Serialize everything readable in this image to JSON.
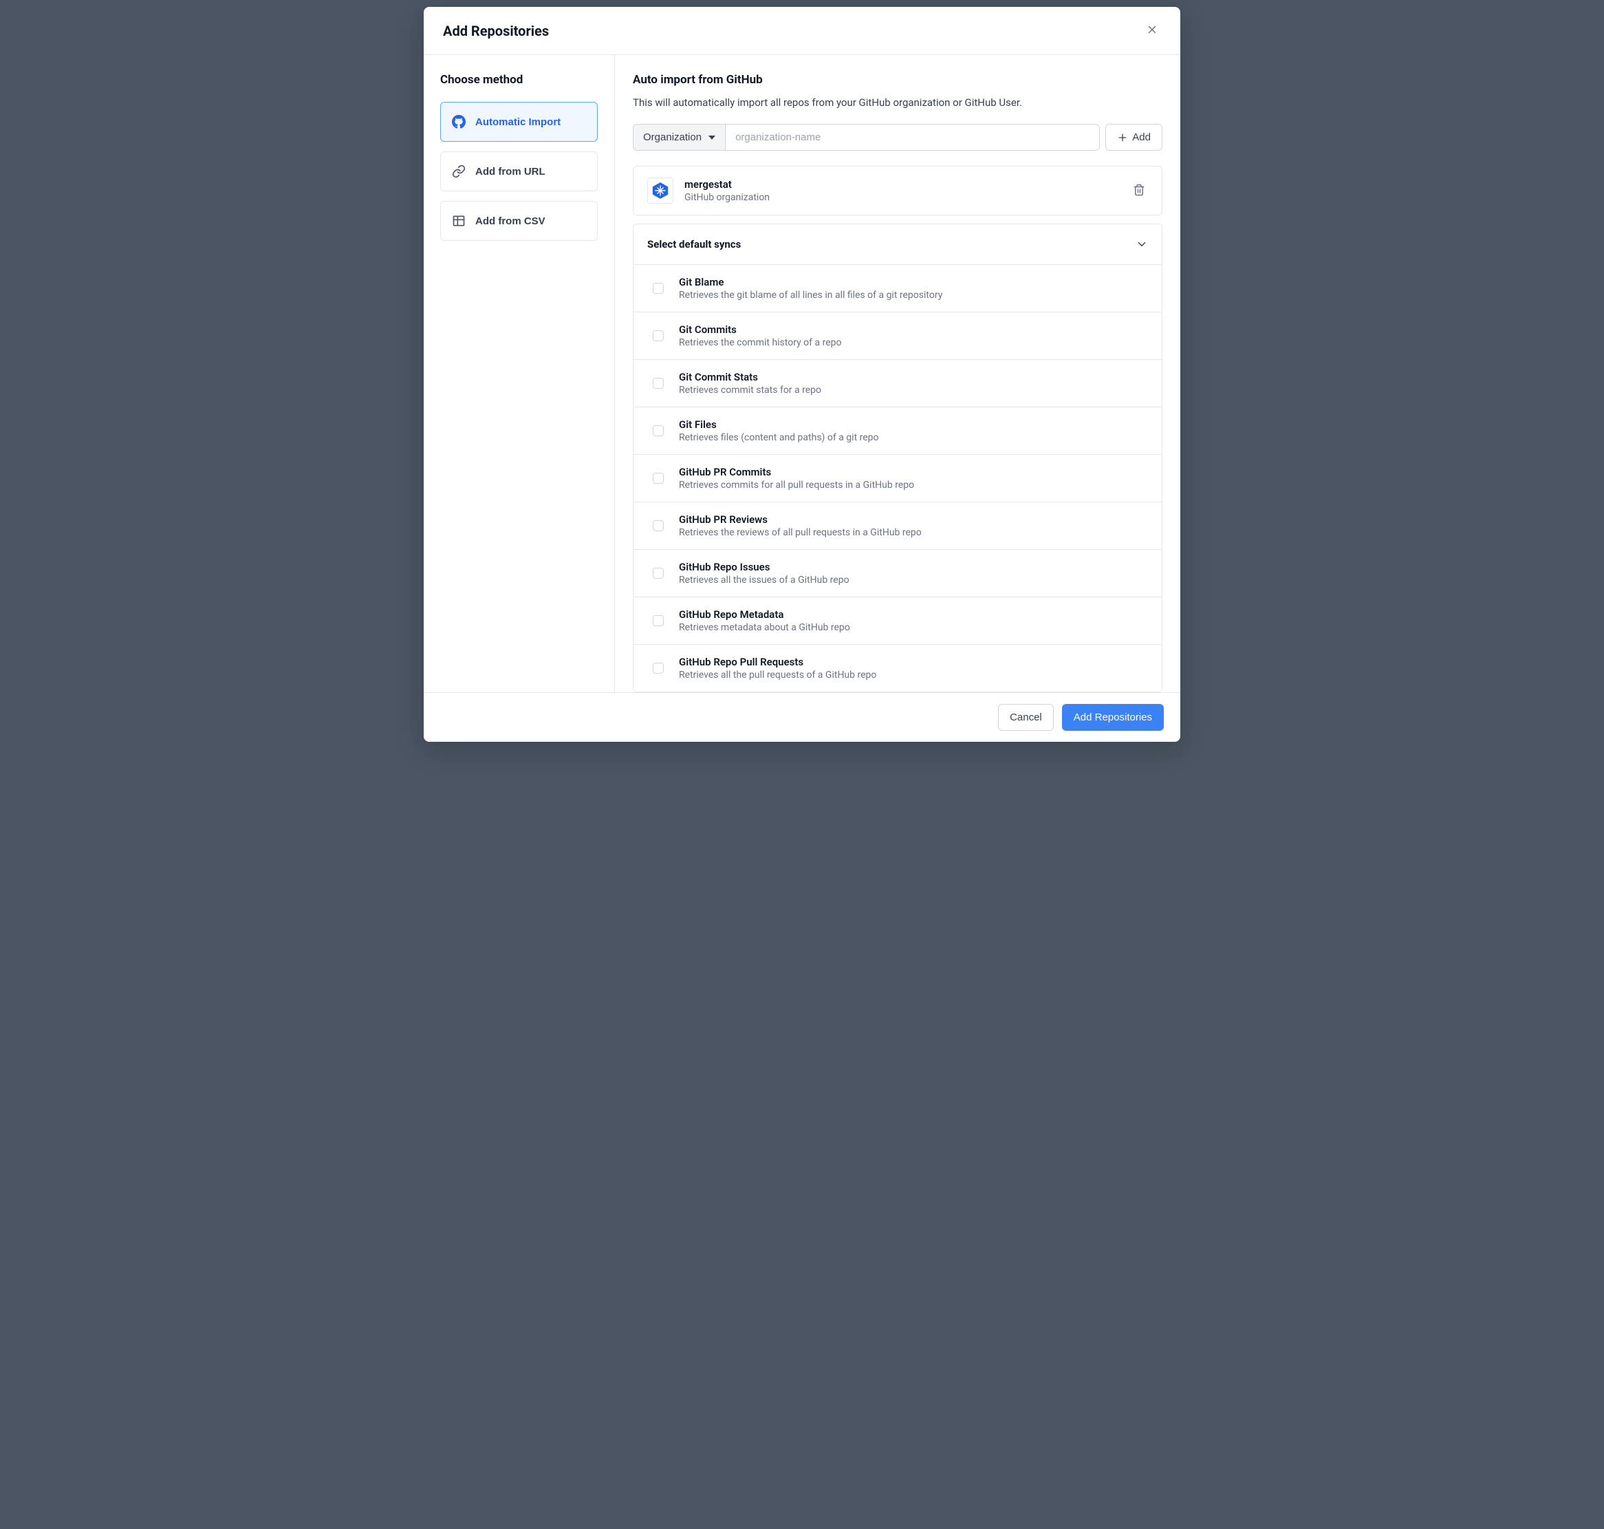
{
  "header": {
    "title": "Add Repositories"
  },
  "sidebar": {
    "title": "Choose method",
    "methods": [
      {
        "label": "Automatic Import"
      },
      {
        "label": "Add from URL"
      },
      {
        "label": "Add from CSV"
      }
    ]
  },
  "main": {
    "title": "Auto import from GitHub",
    "description": "This will automatically import all repos from your GitHub organization or GitHub User.",
    "dropdown_label": "Organization",
    "input_placeholder": "organization-name",
    "add_button_label": "Add",
    "org": {
      "name": "mergestat",
      "subtitle": "GitHub organization"
    },
    "syncs_header": "Select default syncs",
    "syncs": [
      {
        "title": "Git Blame",
        "desc": "Retrieves the git blame of all lines in all files of a git repository"
      },
      {
        "title": "Git Commits",
        "desc": "Retrieves the commit history of a repo"
      },
      {
        "title": "Git Commit Stats",
        "desc": "Retrieves commit stats for a repo"
      },
      {
        "title": "Git Files",
        "desc": "Retrieves files (content and paths) of a git repo"
      },
      {
        "title": "GitHub PR Commits",
        "desc": "Retrieves commits for all pull requests in a GitHub repo"
      },
      {
        "title": "GitHub PR Reviews",
        "desc": "Retrieves the reviews of all pull requests in a GitHub repo"
      },
      {
        "title": "GitHub Repo Issues",
        "desc": "Retrieves all the issues of a GitHub repo"
      },
      {
        "title": "GitHub Repo Metadata",
        "desc": "Retrieves metadata about a GitHub repo"
      },
      {
        "title": "GitHub Repo Pull Requests",
        "desc": "Retrieves all the pull requests of a GitHub repo"
      }
    ]
  },
  "footer": {
    "cancel": "Cancel",
    "submit": "Add Repositories"
  }
}
